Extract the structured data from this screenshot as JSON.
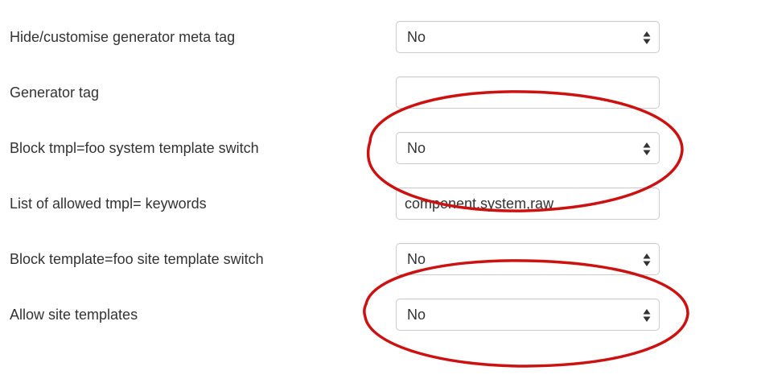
{
  "settings": {
    "rows": [
      {
        "label": "Hide/customise generator meta tag",
        "control": "select",
        "value": "No"
      },
      {
        "label": "Generator tag",
        "control": "text",
        "value": ""
      },
      {
        "label": "Block tmpl=foo system template switch",
        "control": "select",
        "value": "No"
      },
      {
        "label": "List of allowed tmpl= keywords",
        "control": "text",
        "value": "component,system,raw"
      },
      {
        "label": "Block template=foo site template switch",
        "control": "select",
        "value": "No"
      },
      {
        "label": "Allow site templates",
        "control": "select",
        "value": "No"
      }
    ]
  },
  "annotations": {
    "circle_color": "#cc1111",
    "circled_rows": [
      "Block tmpl=foo system template switch",
      "Allow site templates"
    ]
  },
  "icons": {
    "select_arrow": "up-down-caret-icon"
  }
}
